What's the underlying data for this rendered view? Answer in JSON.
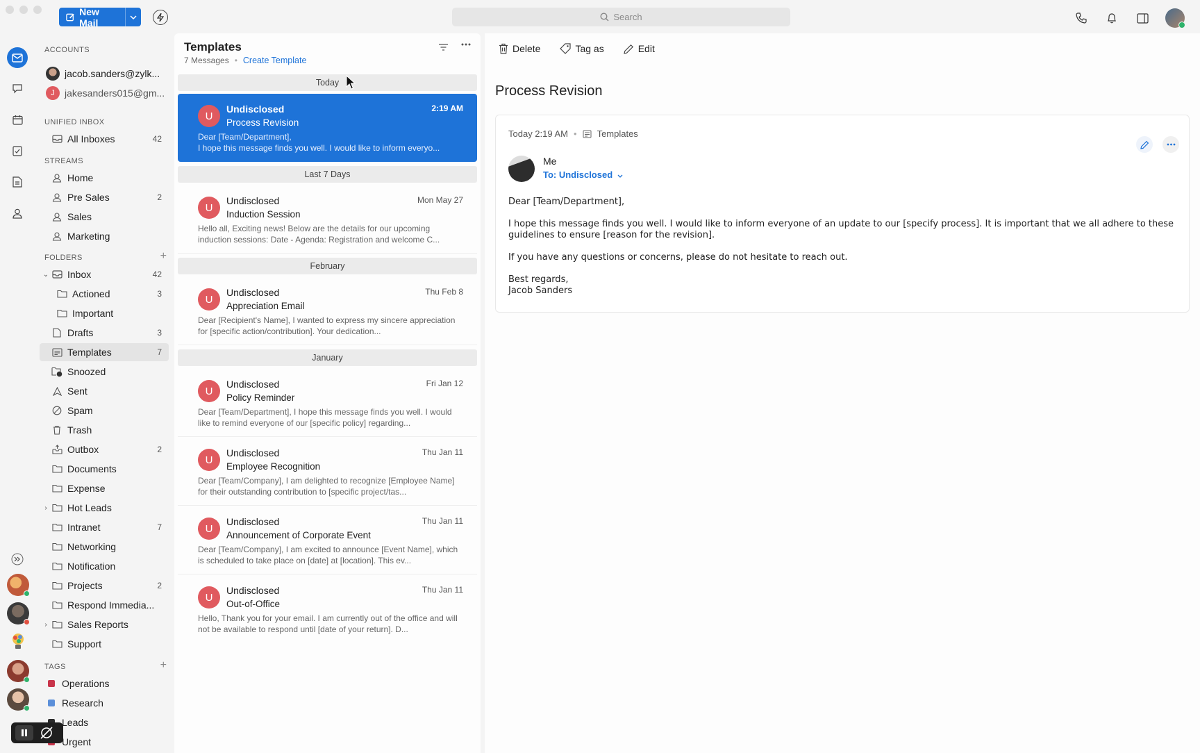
{
  "topbar": {
    "new_mail_label": "New Mail",
    "search_placeholder": "Search"
  },
  "sidebar": {
    "accounts_heading": "ACCOUNTS",
    "accounts": [
      {
        "email": "jacob.sanders@zylk..."
      },
      {
        "email": "jakesanders015@gm...",
        "initial": "J"
      }
    ],
    "unified_heading": "UNIFIED INBOX",
    "unified": [
      {
        "label": "All Inboxes",
        "count": "42"
      }
    ],
    "streams_heading": "STREAMS",
    "streams": [
      {
        "label": "Home",
        "count": ""
      },
      {
        "label": "Pre Sales",
        "count": "2"
      },
      {
        "label": "Sales",
        "count": ""
      },
      {
        "label": "Marketing",
        "count": ""
      }
    ],
    "folders_heading": "FOLDERS",
    "folders": [
      {
        "label": "Inbox",
        "count": "42"
      },
      {
        "label": "Actioned",
        "count": "3"
      },
      {
        "label": "Important",
        "count": ""
      },
      {
        "label": "Drafts",
        "count": "3"
      },
      {
        "label": "Templates",
        "count": "7"
      },
      {
        "label": "Snoozed",
        "count": ""
      },
      {
        "label": "Sent",
        "count": ""
      },
      {
        "label": "Spam",
        "count": ""
      },
      {
        "label": "Trash",
        "count": ""
      },
      {
        "label": "Outbox",
        "count": "2"
      },
      {
        "label": "Documents",
        "count": ""
      },
      {
        "label": "Expense",
        "count": ""
      },
      {
        "label": "Hot Leads",
        "count": ""
      },
      {
        "label": "Intranet",
        "count": "7"
      },
      {
        "label": "Networking",
        "count": ""
      },
      {
        "label": "Notification",
        "count": ""
      },
      {
        "label": "Projects",
        "count": "2"
      },
      {
        "label": "Respond Immedia...",
        "count": ""
      },
      {
        "label": "Sales Reports",
        "count": ""
      },
      {
        "label": "Support",
        "count": ""
      }
    ],
    "tags_heading": "TAGS",
    "tags": [
      {
        "label": "Operations",
        "color": "#c8344a"
      },
      {
        "label": "Research",
        "color": "#5b8fd9"
      },
      {
        "label": "Leads",
        "color": "#2b2b2b"
      },
      {
        "label": "Urgent",
        "color": "#c8344a"
      }
    ]
  },
  "list": {
    "title": "Templates",
    "count_text": "7 Messages",
    "create_link": "Create Template",
    "groups": [
      "Today",
      "Last 7 Days",
      "February",
      "January"
    ],
    "messages": [
      {
        "initial": "U",
        "from": "Undisclosed",
        "date": "2:19 AM",
        "subject": "Process Revision",
        "preview": "Dear [Team/Department],\nI hope this message finds you well. I would like to inform everyo..."
      },
      {
        "initial": "U",
        "from": "Undisclosed",
        "date": "Mon May 27",
        "subject": "Induction Session",
        "preview": "Hello all, Exciting news! Below are the details for our upcoming induction sessions: Date - Agenda: Registration and welcome C..."
      },
      {
        "initial": "U",
        "from": "Undisclosed",
        "date": "Thu Feb 8",
        "subject": "Appreciation Email",
        "preview": "Dear [Recipient's Name], I wanted to express my sincere appreciation for [specific action/contribution]. Your dedication..."
      },
      {
        "initial": "U",
        "from": "Undisclosed",
        "date": "Fri Jan 12",
        "subject": "Policy Reminder",
        "preview": "Dear [Team/Department], I hope this message finds you well. I would like to remind everyone of our [specific policy] regarding..."
      },
      {
        "initial": "U",
        "from": "Undisclosed",
        "date": "Thu Jan 11",
        "subject": "Employee Recognition",
        "preview": "Dear [Team/Company], I am delighted to recognize [Employee Name] for their outstanding contribution to [specific project/tas..."
      },
      {
        "initial": "U",
        "from": "Undisclosed",
        "date": "Thu Jan 11",
        "subject": "Announcement of Corporate Event",
        "preview": "Dear [Team/Company], I am excited to announce [Event Name], which is scheduled to take place on [date] at [location]. This ev..."
      },
      {
        "initial": "U",
        "from": "Undisclosed",
        "date": "Thu Jan 11",
        "subject": "Out-of-Office",
        "preview": "Hello, Thank you for your email. I am currently out of the office and will not be available to respond until [date of your return]. D..."
      }
    ]
  },
  "reader": {
    "toolbar": {
      "delete": "Delete",
      "tag": "Tag as",
      "edit": "Edit"
    },
    "title": "Process Revision",
    "meta_time": "Today 2:19 AM",
    "meta_folder": "Templates",
    "sender": "Me",
    "to": "To: Undisclosed",
    "body": {
      "greeting": "Dear [Team/Department],",
      "p1": "I hope this message finds you well. I would like to inform everyone of an update to our [specify process]. It is important that we all adhere to these guidelines to ensure [reason for the revision].",
      "p2": "If you have any questions or concerns, please do not hesitate to reach out.",
      "closing": "Best regards,",
      "signature": "Jacob Sanders"
    }
  },
  "colors": {
    "accent": "#1e73d8",
    "avatar_red": "#e05a5f",
    "online": "#2fb36b"
  }
}
